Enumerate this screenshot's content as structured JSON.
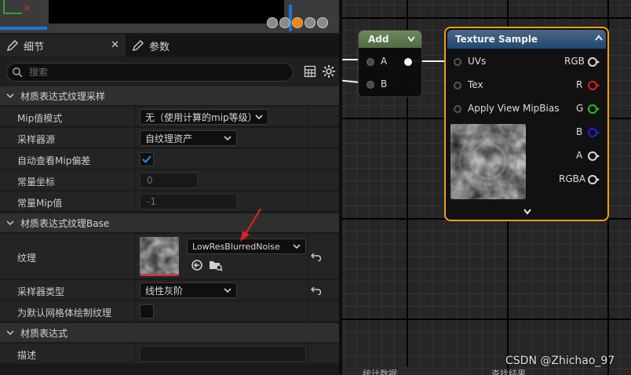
{
  "tabs": [
    {
      "label": "细节",
      "active": true
    },
    {
      "label": "参数",
      "active": false
    }
  ],
  "search": {
    "placeholder": "搜索"
  },
  "sections": {
    "sampling": {
      "title": "材质表达式纹理采样",
      "rows": {
        "mip_mode": {
          "label": "Mip值模式",
          "value": "无（使用计算的mip等级）"
        },
        "sampler_source": {
          "label": "采样器源",
          "value": "自纹理资产"
        },
        "auto_view_mip_bias": {
          "label": "自动查看Mip偏差",
          "checked": true
        },
        "const_coordinate": {
          "label": "常量坐标",
          "value": "0"
        },
        "const_mip_value": {
          "label": "常量Mip值",
          "value": "-1"
        }
      }
    },
    "base": {
      "title": "材质表达式纹理Base",
      "rows": {
        "texture": {
          "label": "纹理",
          "value": "LowResBlurredNoise"
        },
        "sampler_type": {
          "label": "采样器类型",
          "value": "线性灰阶"
        },
        "render_default_mesh": {
          "label": "为默认网格体绘制纹理",
          "checked": false
        }
      }
    },
    "expression": {
      "title": "材质表达式",
      "rows": {
        "desc": {
          "label": "描述",
          "value": ""
        }
      }
    }
  },
  "graph": {
    "add_node": {
      "title": "Add",
      "inputs": [
        "A",
        "B"
      ]
    },
    "texture_node": {
      "title": "Texture Sample",
      "inputs": [
        "UVs",
        "Tex",
        "Apply View MipBias"
      ],
      "outputs": [
        "RGB",
        "R",
        "G",
        "B",
        "A",
        "RGBA"
      ],
      "output_colors": {
        "RGB": "#d8d8d8",
        "R": "#e02020",
        "G": "#20c020",
        "B": "#2020e0",
        "A": "#d8d8d8",
        "RGBA": "#d8d8d8"
      },
      "accent": "#f39c12"
    },
    "bottom_tabs": [
      "统计数据",
      "查找结果"
    ],
    "watermark": "CSDN @Zhichao_97"
  },
  "colors": {
    "selection_blue": "#1a76d2",
    "checkbox_blue": "#2f8ce0",
    "warning_red": "#e02020"
  }
}
